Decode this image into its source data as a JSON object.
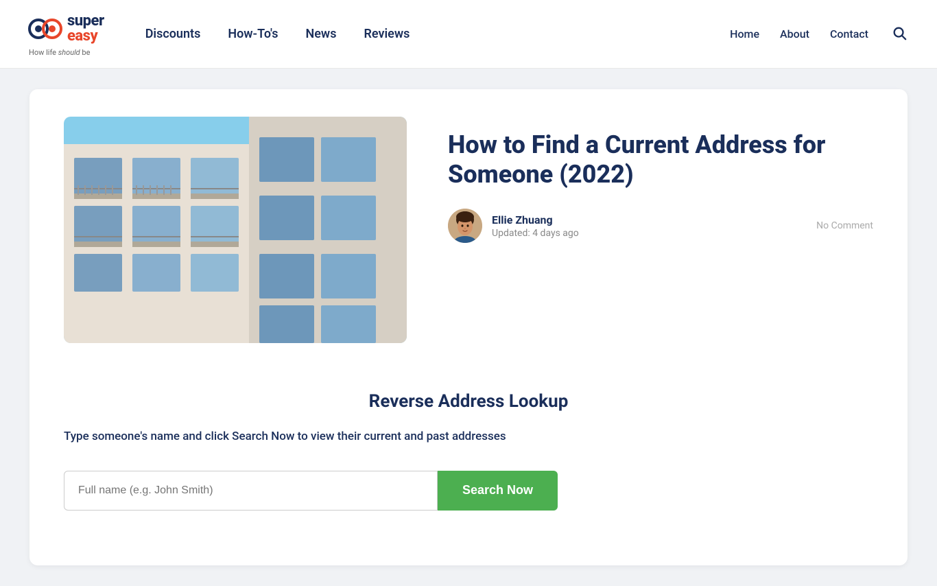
{
  "header": {
    "logo": {
      "super_text": "super",
      "easy_text": "easy",
      "tagline_prefix": "How life ",
      "tagline_italic": "should",
      "tagline_suffix": " be"
    },
    "nav": {
      "items": [
        {
          "label": "Discounts",
          "href": "#"
        },
        {
          "label": "How-To's",
          "href": "#"
        },
        {
          "label": "News",
          "href": "#"
        },
        {
          "label": "Reviews",
          "href": "#"
        }
      ]
    },
    "right_nav": {
      "items": [
        {
          "label": "Home",
          "href": "#"
        },
        {
          "label": "About",
          "href": "#"
        },
        {
          "label": "Contact",
          "href": "#"
        }
      ]
    }
  },
  "article": {
    "title": "How to Find a Current Address for Someone (2022)",
    "author": {
      "name": "Ellie Zhuang",
      "updated": "Updated: 4 days ago"
    },
    "no_comment_label": "No Comment"
  },
  "widget": {
    "title": "Reverse Address Lookup",
    "description": "Type someone's name and click Search Now to view their current and past addresses",
    "input_placeholder": "Full name (e.g. John Smith)",
    "button_label": "Search Now"
  },
  "icons": {
    "search": "🔍"
  }
}
